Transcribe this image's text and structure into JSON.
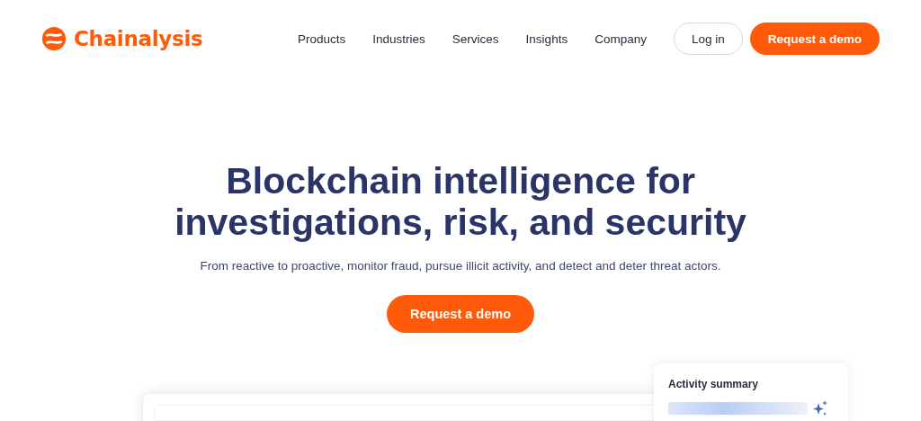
{
  "header": {
    "brand": "Chainalysis",
    "nav": [
      "Products",
      "Industries",
      "Services",
      "Insights",
      "Company"
    ],
    "login": "Log in",
    "demo": "Request a demo"
  },
  "hero": {
    "title_lines": [
      "Blockchain intelligence for",
      "investigations, risk, and security"
    ],
    "subtitle": "From reactive to proactive, monitor fraud, pursue illicit activity, and detect and deter threat actors.",
    "cta": "Request a demo"
  },
  "activity_card": {
    "title": "Activity summary"
  }
}
